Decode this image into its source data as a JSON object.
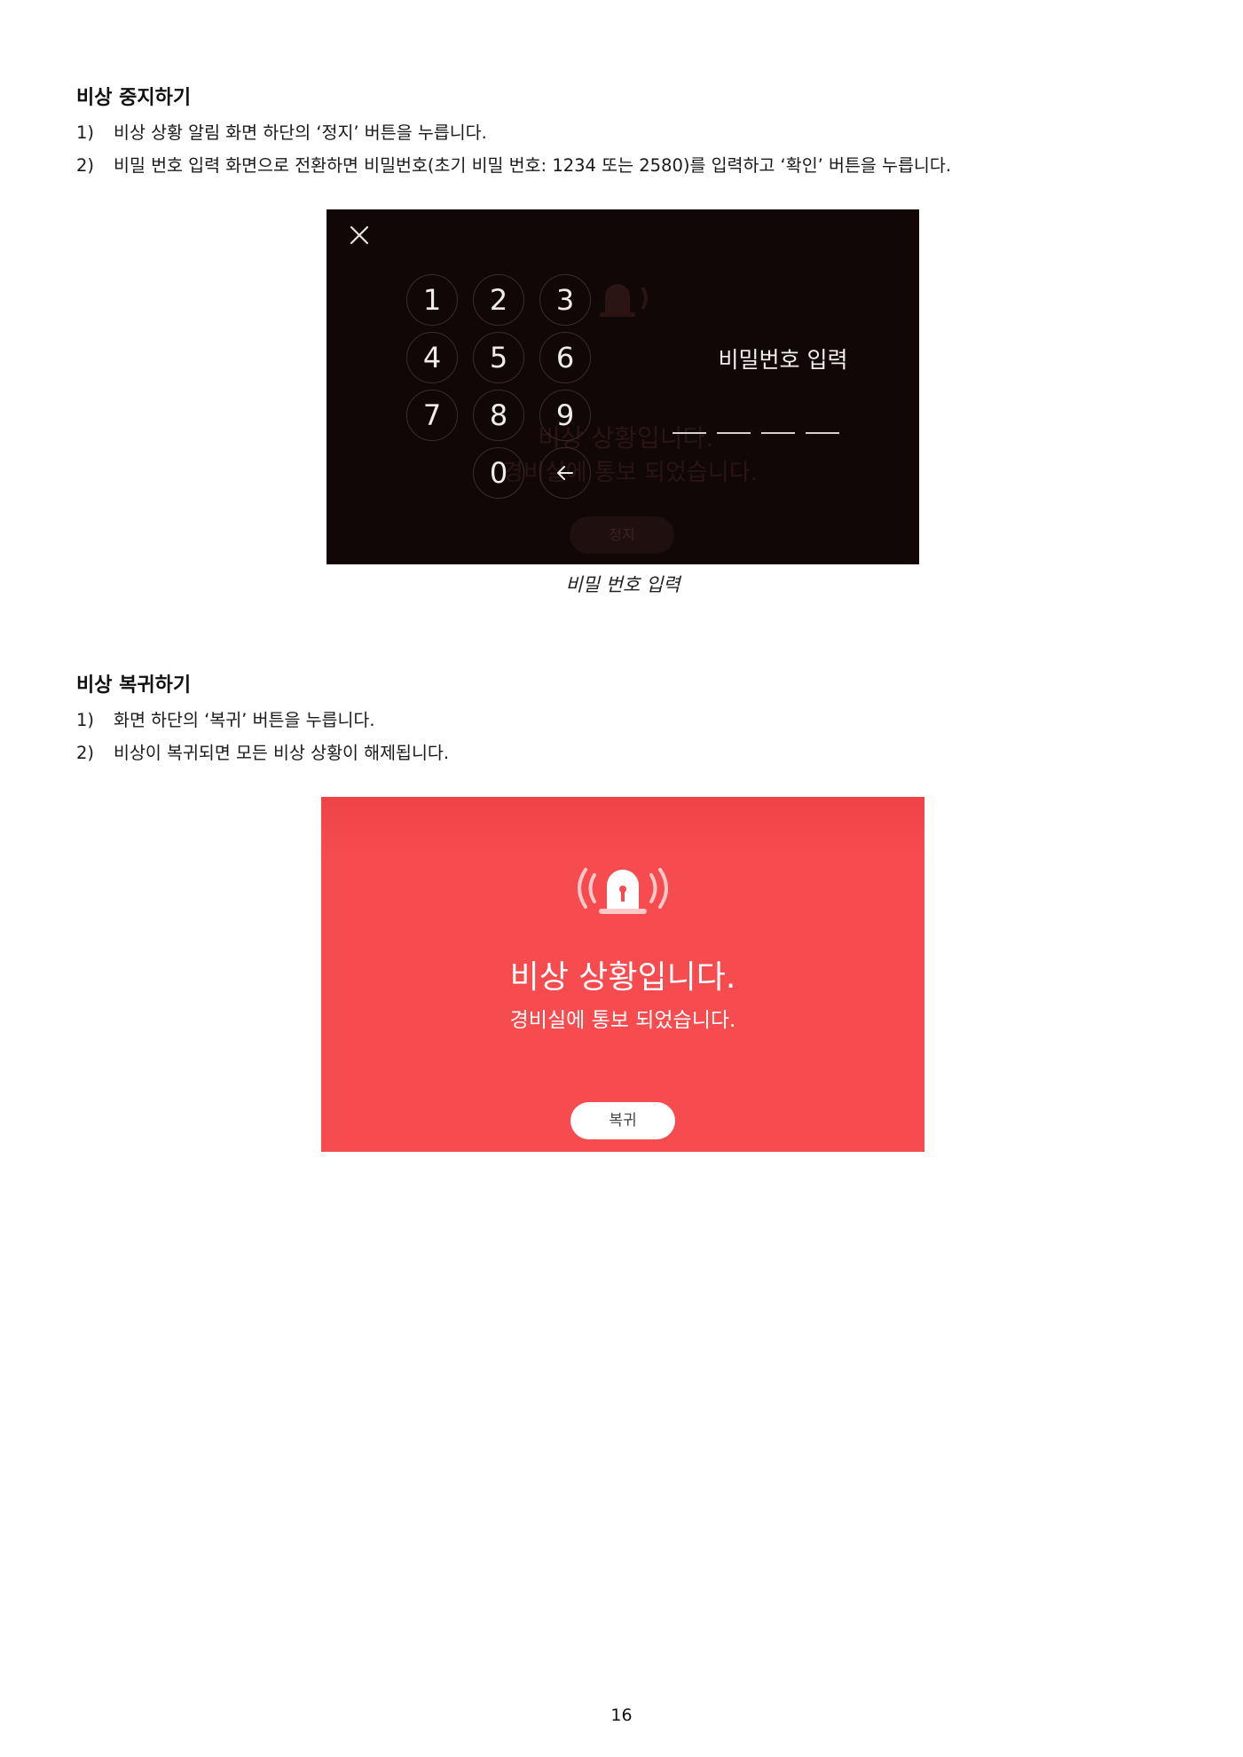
{
  "section1": {
    "heading": "비상 중지하기",
    "steps": [
      {
        "num": "1)",
        "text": "비상 상황 알림 화면 하단의 ‘정지’ 버튼을 누릅니다."
      },
      {
        "num": "2)",
        "text": "비밀 번호 입력 화면으로 전환하면 비밀번호(초기 비밀 번호: 1234 또는 2580)를 입력하고 ‘확인’ 버튼을 누릅니다."
      }
    ]
  },
  "keypad_screen": {
    "keys": [
      "1",
      "2",
      "3",
      "4",
      "5",
      "6",
      "7",
      "8",
      "9",
      "0",
      "←"
    ],
    "title": "비밀번호 입력",
    "background_text": {
      "line1": "비상 상황입니다.",
      "line2": "경비실에 통보 되었습니다.",
      "button": "정지"
    },
    "caption": "비밀 번호 입력",
    "colors": {
      "background": "#120707",
      "text": "#f1ecec"
    }
  },
  "section2": {
    "heading": "비상 복귀하기",
    "steps": [
      {
        "num": "1)",
        "text": "화면 하단의 ‘복귀’ 버튼을 누릅니다."
      },
      {
        "num": "2)",
        "text": "비상이 복귀되면 모든 비상 상황이 해제됩니다."
      }
    ]
  },
  "alarm_screen": {
    "title": "비상 상황입니다.",
    "subtitle": "경비실에 통보 되었습니다.",
    "button": "복귀",
    "icon": "siren-icon",
    "colors": {
      "background": "#f64c4f",
      "text": "#ffffff"
    }
  },
  "page_number": "16"
}
